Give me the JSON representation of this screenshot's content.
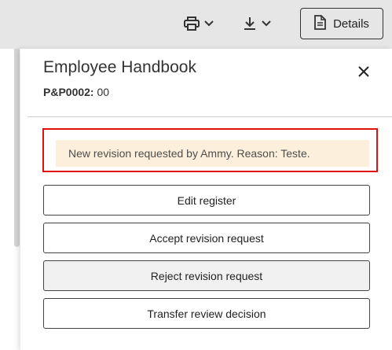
{
  "toolbar": {
    "print_icon": "printer-icon",
    "download_icon": "download-icon",
    "details_label": "Details",
    "details_icon": "document-icon"
  },
  "panel": {
    "title": "Employee Handbook",
    "code_label": "P&P0002:",
    "code_value": "00",
    "close_icon": "close-icon",
    "notice": "New revision requested by Ammy. Reason: Teste.",
    "notice_highlight_color": "#dd1111",
    "notice_bg_color": "#fcf0dc",
    "actions": [
      {
        "label": "Edit register"
      },
      {
        "label": "Accept revision request"
      },
      {
        "label": "Reject revision request"
      },
      {
        "label": "Transfer review decision"
      }
    ]
  }
}
